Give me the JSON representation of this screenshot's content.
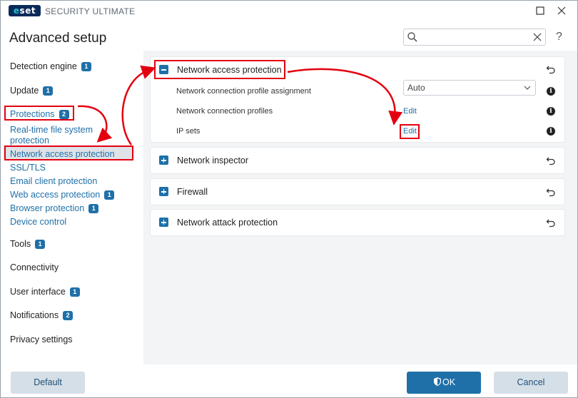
{
  "app": {
    "logo_text": "eset",
    "title": "SECURITY ULTIMATE"
  },
  "header": {
    "page_title": "Advanced setup",
    "search_value": "",
    "help": "?"
  },
  "sidebar": {
    "items": [
      {
        "label": "Detection engine",
        "badge": "1"
      },
      {
        "label": "Update",
        "badge": "1"
      },
      {
        "label": "Protections",
        "badge": "2"
      },
      {
        "label": "Real-time file system protection",
        "badge": ""
      },
      {
        "label": "Network access protection",
        "badge": ""
      },
      {
        "label": "SSL/TLS",
        "badge": ""
      },
      {
        "label": "Email client protection",
        "badge": ""
      },
      {
        "label": "Web access protection",
        "badge": "1"
      },
      {
        "label": "Browser protection",
        "badge": "1"
      },
      {
        "label": "Device control",
        "badge": ""
      },
      {
        "label": "Tools",
        "badge": "1"
      },
      {
        "label": "Connectivity",
        "badge": ""
      },
      {
        "label": "User interface",
        "badge": "1"
      },
      {
        "label": "Notifications",
        "badge": "2"
      },
      {
        "label": "Privacy settings",
        "badge": ""
      }
    ],
    "rtfs_line1": "Real-time file system",
    "rtfs_line2": "protection"
  },
  "main": {
    "panels": [
      {
        "title": "Network access protection",
        "expanded": true,
        "rows": [
          {
            "label": "Network connection profile assignment",
            "control": "dropdown",
            "value": "Auto"
          },
          {
            "label": "Network connection profiles",
            "control": "link",
            "value": "Edit"
          },
          {
            "label": "IP sets",
            "control": "link",
            "value": "Edit"
          }
        ]
      },
      {
        "title": "Network inspector",
        "expanded": false
      },
      {
        "title": "Firewall",
        "expanded": false
      },
      {
        "title": "Network attack protection",
        "expanded": false
      }
    ]
  },
  "footer": {
    "default_label": "Default",
    "ok_label": "OK",
    "cancel_label": "Cancel"
  },
  "colors": {
    "accent": "#1f70a8",
    "highlight": "#e3000f",
    "button_secondary": "#d5dfe7"
  }
}
